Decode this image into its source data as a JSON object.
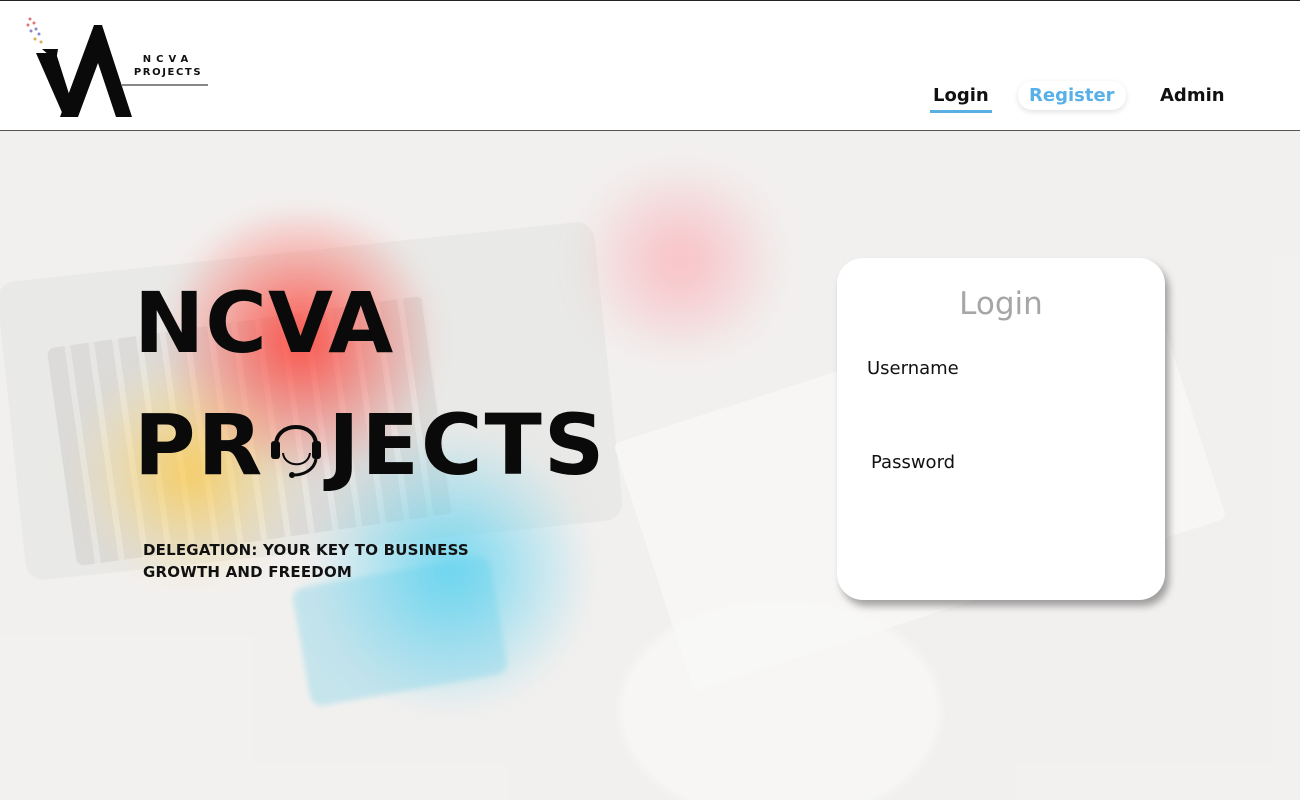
{
  "header": {
    "logo": {
      "line1": "NCVA",
      "line2": "PROJECTS"
    },
    "nav": {
      "login": "Login",
      "register": "Register",
      "admin": "Admin"
    }
  },
  "hero": {
    "title_line1": "NCVA",
    "title_line2_prefix": "PR",
    "title_line2_suffix": "JECTS",
    "tagline": "DELEGATION: YOUR KEY TO BUSINESS GROWTH AND FREEDOM"
  },
  "login_card": {
    "title": "Login",
    "username_label": "Username",
    "username_value": "",
    "password_label": "Password",
    "password_value": ""
  },
  "colors": {
    "accent_blue": "#58b0e8",
    "title_gray": "#a6a6a6",
    "text_dark": "#111111"
  }
}
